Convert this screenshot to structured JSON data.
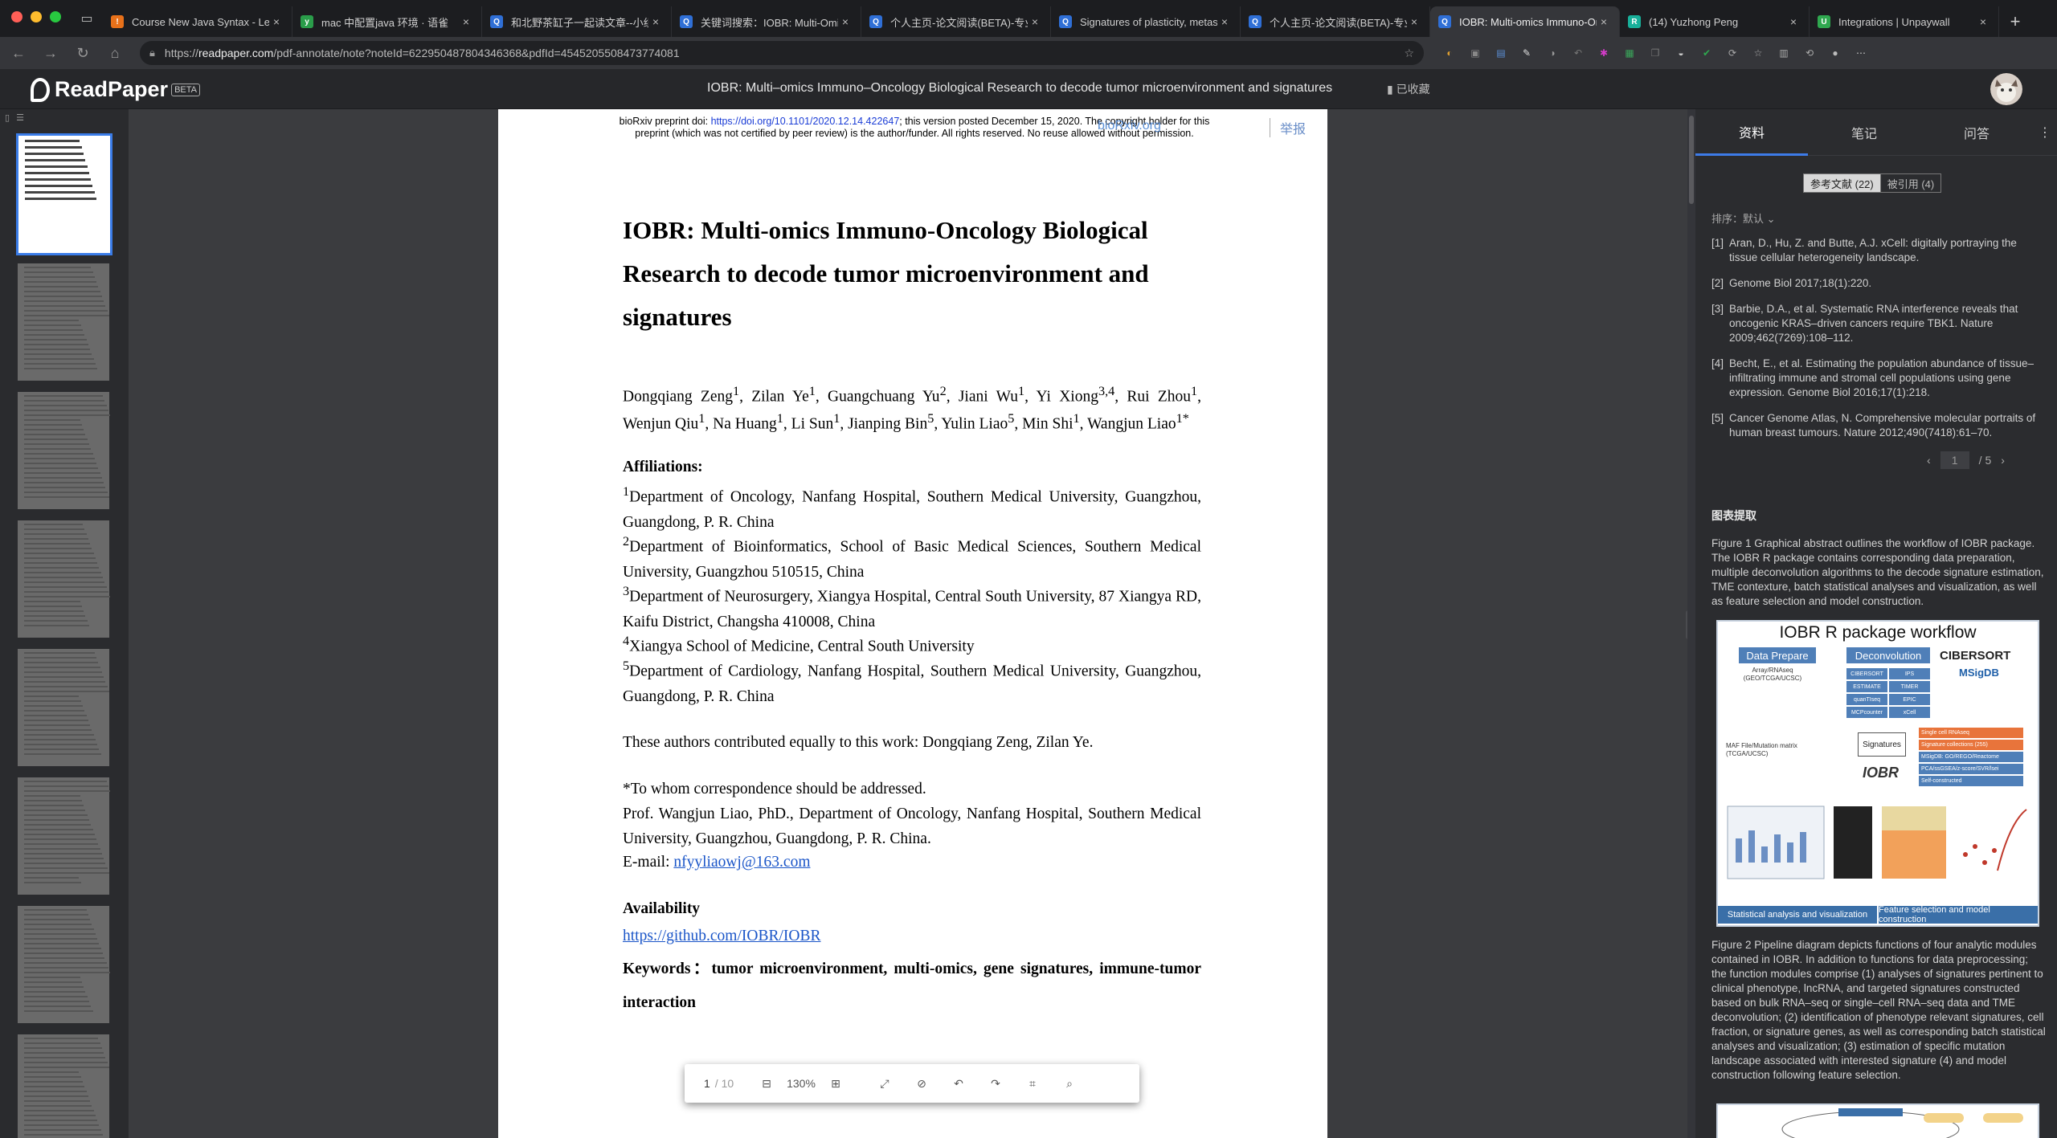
{
  "window": {
    "traffic_colors": [
      "#ff5f57",
      "#febc2e",
      "#28c840"
    ]
  },
  "tabs": [
    {
      "title": "Course New Java Syntax - Lev",
      "favicon_color": "#e8711a",
      "favicon_glyph": "!"
    },
    {
      "title": "mac 中配置java 环境 · 语雀",
      "favicon_color": "#2a9d4a",
      "favicon_glyph": "y"
    },
    {
      "title": "和北野茶缸子一起读文章--小组",
      "favicon_color": "#2f6fd6",
      "favicon_glyph": "Q"
    },
    {
      "title": "关键词搜索：IOBR: Multi-Omi",
      "favicon_color": "#2f6fd6",
      "favicon_glyph": "Q"
    },
    {
      "title": "个人主页-论文阅读(BETA)-专业",
      "favicon_color": "#2f6fd6",
      "favicon_glyph": "Q"
    },
    {
      "title": "Signatures of plasticity, metas",
      "favicon_color": "#2f6fd6",
      "favicon_glyph": "Q"
    },
    {
      "title": "个人主页-论文阅读(BETA)-专业",
      "favicon_color": "#2f6fd6",
      "favicon_glyph": "Q"
    },
    {
      "title": "IOBR: Multi-omics Immuno-On",
      "favicon_color": "#2f6fd6",
      "favicon_glyph": "Q",
      "active": true
    },
    {
      "title": "(14) Yuzhong Peng",
      "favicon_color": "#18b09a",
      "favicon_glyph": "R"
    },
    {
      "title": "Integrations | Unpaywall",
      "favicon_color": "#2fa84f",
      "favicon_glyph": "U"
    }
  ],
  "address": {
    "host": "readpaper.com",
    "path": "/pdf-annotate/note?noteId=622950487804346368&pdfId=4545205508473774081",
    "scheme": "https://"
  },
  "extensions": [
    "palette-icon",
    "image-icon",
    "doc-icon",
    "pen-icon",
    "dark-icon",
    "undo-icon",
    "puzzle-color-icon",
    "sheet-icon",
    "copy-icon",
    "edge-icon",
    "check-icon",
    "refresh-icon",
    "star-list-icon",
    "collections-icon",
    "history-icon",
    "profile-icon",
    "more-icon"
  ],
  "app": {
    "logo_text": "ReadPaper",
    "beta": "BETA",
    "doc_title": "IOBR: Multi–omics Immuno–Oncology Biological Research to decode tumor microenvironment and signatures",
    "favorited": "已收藏"
  },
  "page": {
    "preprint_1": "bioRxiv preprint doi: ",
    "doi_link": "https://doi.org/10.1101/2020.12.14.422647",
    "preprint_2": "; this version posted December 15, 2020. The copyright holder for this",
    "preprint_3": "preprint (which was not certified by peer review) is the author/funder. All rights reserved. No reuse allowed without permission.",
    "biorxiv": "bioRxiv.org",
    "report": "举报",
    "title": "IOBR: Multi-omics Immuno-Oncology Biological Research to decode tumor microenvironment and signatures",
    "affiliations_label": "Affiliations:",
    "aff1": "Department of Oncology, Nanfang Hospital, Southern Medical University, Guangzhou, Guangdong, P. R. China",
    "aff2": "Department of Bioinformatics, School of Basic Medical Sciences, Southern Medical University, Guangzhou 510515, China",
    "aff3": "Department of Neurosurgery, Xiangya Hospital, Central South University, 87 Xiangya RD, Kaifu District, Changsha 410008, China",
    "aff4": "Xiangya School of Medicine, Central South University",
    "aff5": "Department of Cardiology, Nanfang Hospital, Southern Medical University, Guangzhou, Guangdong, P. R. China",
    "equal": "These authors contributed equally to this work: Dongqiang Zeng, Zilan Ye.",
    "corr_label": "*To whom correspondence should be addressed.",
    "corr": "Prof. Wangjun Liao, PhD., Department of Oncology, Nanfang Hospital, Southern Medical University, Guangzhou, Guangdong, P. R. China.",
    "email_label": "E-mail: ",
    "email": "nfyyliaowj@163.com",
    "avail_label": "Availability",
    "github": "https://github.com/IOBR/IOBR",
    "keywords_label": "Keywords：",
    "keywords": "tumor microenvironment, multi-omics, gene signatures, immune-tumor interaction"
  },
  "toolbar": {
    "page_current": "1",
    "page_total": "/ 10",
    "zoom": "130%"
  },
  "panel": {
    "tabs": [
      "资料",
      "笔记",
      "问答"
    ],
    "refs_tab": "参考文献 (22)",
    "cited_tab": "被引用 (4)",
    "sort_label": "排序：",
    "sort_value": "默认",
    "references": [
      {
        "n": "[1]",
        "text": "Aran, D., Hu, Z. and Butte, A.J. xCell: digitally portraying the tissue cellular heterogeneity landscape."
      },
      {
        "n": "[2]",
        "text": "Genome Biol 2017;18(1):220."
      },
      {
        "n": "[3]",
        "text": "Barbie, D.A., et al. Systematic RNA interference reveals that oncogenic KRAS–driven cancers require TBK1. Nature 2009;462(7269):108–112."
      },
      {
        "n": "[4]",
        "text": "Becht, E., et al. Estimating the population abundance of tissue–infiltrating immune and stromal cell populations using gene expression. Genome Biol 2016;17(1):218."
      },
      {
        "n": "[5]",
        "text": "Cancer Genome Atlas, N. Comprehensive molecular portraits of human breast tumours. Nature 2012;490(7418):61–70."
      }
    ],
    "pager_current": "1",
    "pager_total": "/ 5",
    "figures_section": "图表提取",
    "fig1_caption": "Figure 1 Graphical abstract outlines the workflow of IOBR package. The IOBR R package contains corresponding data preparation, multiple deconvolution algorithms to the decode signature estimation, TME contexture, batch statistical analyses and visualization, as well as feature selection and model construction.",
    "fig1_title": "IOBR R package workflow",
    "fig1_box_data": "Data Prepare",
    "fig1_box_deconv": "Deconvolution",
    "fig1_cibersort": "CIBERSORT",
    "fig1_msigdb": "MSigDB",
    "fig1_methods": [
      "CIBERSORT",
      "IPS",
      "ESTIMATE",
      "TIMER",
      "quanTIseq",
      "EPIC",
      "MCPcounter",
      "xCell"
    ],
    "fig1_sig_items": [
      "Single cell RNAseq",
      "Signature collections (255)",
      "MSigDB: GO/REGO/Reactome",
      "PCA/ssGSEA/z-score/SVR/lsei",
      "Self-constructed"
    ],
    "fig1_signatures": "Signatures",
    "fig1_iobr": "IOBR",
    "fig1_arraylabel": "Array/RNAseq (GEO/TCGA/UCSC)",
    "fig1_maflabel": "MAF File/Mutation matrix (TCGA/UCSC)",
    "fig1_bottom_left": "Statistical analysis and visualization",
    "fig1_bottom_right": "Feature selection and model construction",
    "fig2_caption": "Figure 2 Pipeline diagram depicts functions of four analytic modules contained in IOBR. In addition to functions for data preprocessing; the function modules comprise (1) analyses of signatures pertinent to clinical phenotype, lncRNA, and targeted signatures constructed based on bulk RNA–seq or single–cell RNA–seq data and TME deconvolution; (2) identification of phenotype relevant signatures, cell fraction, or signature genes, as well as corresponding batch statistical analyses and visualization; (3) estimation of specific mutation landscape associated with interested signature (4) and model construction following feature selection."
  }
}
